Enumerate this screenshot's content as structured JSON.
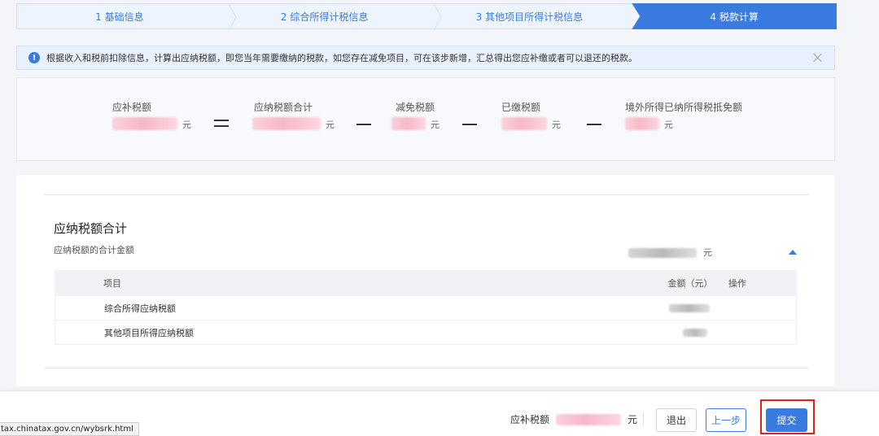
{
  "steps": [
    {
      "label": "1 基础信息",
      "active": false
    },
    {
      "label": "2 综合所得计税信息",
      "active": false
    },
    {
      "label": "3 其他项目所得计税信息",
      "active": false
    },
    {
      "label": "4 税款计算",
      "active": true
    }
  ],
  "banner": {
    "message": "根据收入和税前扣除信息，计算出应纳税额，即您当年需要缴纳的税款，如您存在减免项目，可在该步新增，汇总得出您应补缴或者可以退还的税款。",
    "icon": "info-icon"
  },
  "formula": {
    "items": [
      {
        "label": "应补税额",
        "unit": "元"
      },
      {
        "label": "应纳税额合计",
        "unit": "元"
      },
      {
        "label": "减免税额",
        "unit": "元"
      },
      {
        "label": "已缴税额",
        "unit": "元"
      },
      {
        "label": "境外所得已纳所得税抵免额",
        "unit": "元"
      }
    ]
  },
  "section": {
    "title": "应纳税额合计",
    "subtitle": "应纳税额的合计金额",
    "total_unit": "元",
    "table": {
      "headers": [
        "项目",
        "金额（元）",
        "操作"
      ],
      "rows": [
        {
          "item": "综合所得应纳税额"
        },
        {
          "item": "其他项目所得应纳税额"
        }
      ]
    }
  },
  "bottom": {
    "total_label": "应补税额",
    "total_unit": "元",
    "exit_label": "退出",
    "prev_label": "上一步",
    "submit_label": "提交"
  },
  "status_url": "tax.chinatax.gov.cn/wybsrk.html",
  "colors": {
    "accent": "#3a7be0",
    "highlight": "#e0201c"
  }
}
